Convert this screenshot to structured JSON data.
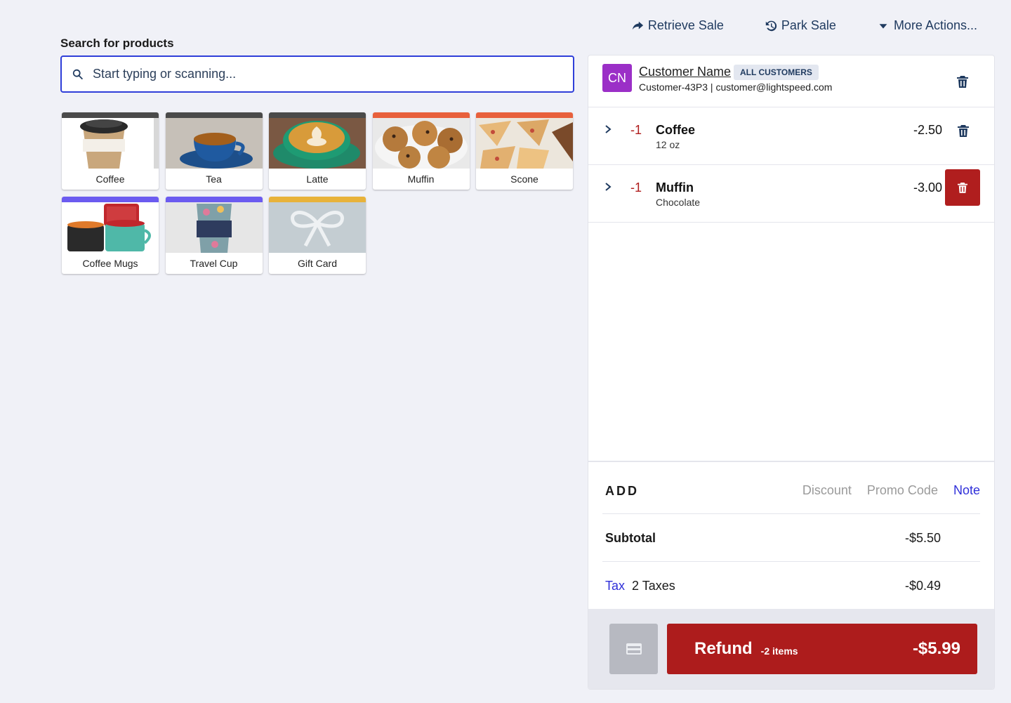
{
  "header": {
    "actions": [
      {
        "label": "Retrieve Sale",
        "icon": "share-arrow-icon"
      },
      {
        "label": "Park Sale",
        "icon": "history-icon"
      },
      {
        "label": "More Actions...",
        "icon": "caret-down-icon"
      }
    ]
  },
  "search": {
    "label": "Search for products",
    "placeholder": "Start typing or scanning..."
  },
  "products": [
    {
      "label": "Coffee",
      "bar_color": "#4a4a4a"
    },
    {
      "label": "Tea",
      "bar_color": "#4a4a4a"
    },
    {
      "label": "Latte",
      "bar_color": "#4a4a4a"
    },
    {
      "label": "Muffin",
      "bar_color": "#e8603c"
    },
    {
      "label": "Scone",
      "bar_color": "#e8603c"
    },
    {
      "label": "Coffee Mugs",
      "bar_color": "#6b5bf0"
    },
    {
      "label": "Travel Cup",
      "bar_color": "#6b5bf0"
    },
    {
      "label": "Gift Card",
      "bar_color": "#e8b23a"
    }
  ],
  "customer": {
    "initials": "CN",
    "name": "Customer Name",
    "group": "ALL CUSTOMERS",
    "meta": "Customer-43P3 | customer@lightspeed.com"
  },
  "lines": [
    {
      "qty": "-1",
      "name": "Coffee",
      "variant": "12 oz",
      "price": "-2.50"
    },
    {
      "qty": "-1",
      "name": "Muffin",
      "variant": "Chocolate",
      "price": "-3.00"
    }
  ],
  "add": {
    "title": "ADD",
    "discount": "Discount",
    "promo": "Promo Code",
    "note": "Note"
  },
  "totals": {
    "subtotal_label": "Subtotal",
    "subtotal": "-$5.50",
    "tax_label": "Tax",
    "tax_detail": "2 Taxes",
    "tax": "-$0.49"
  },
  "pay": {
    "label": "Refund",
    "items": "-2 items",
    "amount": "-$5.99"
  },
  "colors": {
    "accent": "#2f3fd9",
    "refund": "#ad1c1c",
    "avatar": "#9b2fc7"
  }
}
